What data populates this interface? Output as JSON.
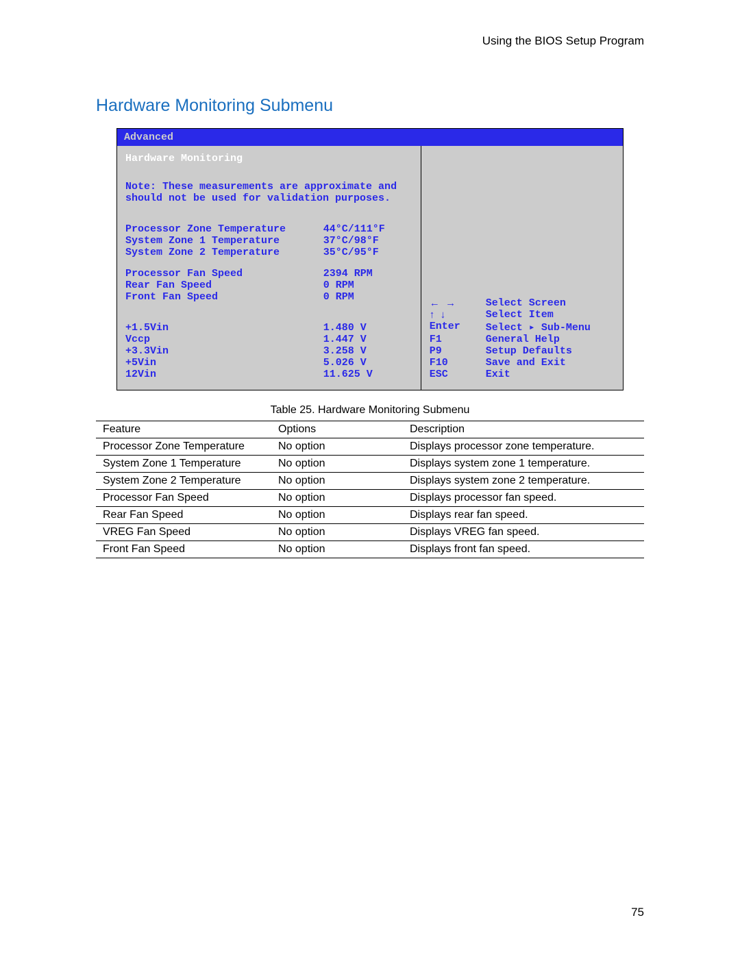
{
  "header": {
    "right_text": "Using the BIOS Setup Program"
  },
  "section_title": "Hardware Monitoring Submenu",
  "bios": {
    "tab": "Advanced",
    "subtitle": "Hardware Monitoring",
    "note_line1": "Note:  These measurements are approximate and",
    "note_line2": "should not be used for validation purposes.",
    "readings": [
      {
        "label": "Processor Zone Temperature",
        "value": "44°C/111°F"
      },
      {
        "label": "System Zone 1 Temperature",
        "value": "37°C/98°F"
      },
      {
        "label": "System Zone 2 Temperature",
        "value": "35°C/95°F"
      }
    ],
    "fans": [
      {
        "label": "Processor Fan Speed",
        "value": "2394 RPM"
      },
      {
        "label": "Rear Fan Speed",
        "value": "0 RPM"
      },
      {
        "label": "Front Fan Speed",
        "value": "0 RPM"
      }
    ],
    "voltages": [
      {
        "label": "+1.5Vin",
        "value": "1.480 V"
      },
      {
        "label": " Vccp",
        "value": "1.447 V"
      },
      {
        "label": "+3.3Vin",
        "value": "3.258 V"
      },
      {
        "label": "+5Vin",
        "value": "5.026 V"
      },
      {
        "label": "12Vin",
        "value": "11.625 V"
      }
    ],
    "help": [
      {
        "key": "←  →",
        "action": "Select Screen"
      },
      {
        "key": "↑  ↓",
        "action": "Select Item"
      },
      {
        "key": "Enter",
        "action": "Select ▸ Sub-Menu"
      },
      {
        "key": "F1",
        "action": "General Help"
      },
      {
        "key": "P9",
        "action": "Setup Defaults"
      },
      {
        "key": "F10",
        "action": "Save and Exit"
      },
      {
        "key": "ESC",
        "action": "Exit"
      }
    ]
  },
  "table_caption": "Table 25.    Hardware Monitoring Submenu",
  "chart_data": {
    "type": "table",
    "columns": [
      "Feature",
      "Options",
      "Description"
    ],
    "rows": [
      [
        "Processor Zone Temperature",
        "No option",
        "Displays processor zone temperature."
      ],
      [
        "System Zone 1 Temperature",
        "No option",
        "Displays system zone 1 temperature."
      ],
      [
        "System Zone 2 Temperature",
        "No option",
        "Displays system zone 2 temperature."
      ],
      [
        "Processor Fan Speed",
        "No option",
        "Displays processor fan speed."
      ],
      [
        "Rear Fan Speed",
        "No option",
        "Displays rear fan speed."
      ],
      [
        "VREG Fan Speed",
        "No option",
        "Displays VREG fan speed."
      ],
      [
        "Front Fan Speed",
        "No option",
        "Displays front fan speed."
      ]
    ]
  },
  "page_number": "75"
}
